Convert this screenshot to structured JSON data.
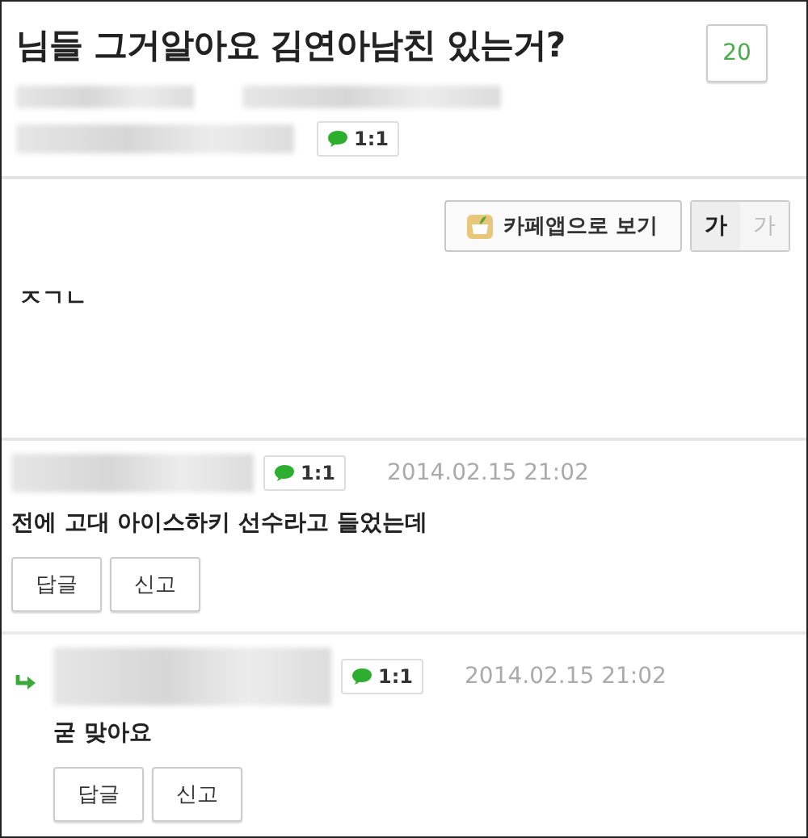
{
  "post": {
    "title": "님들 그거알아요 김연아남친 있는거?",
    "comment_count": "20",
    "chat_label": "1:1"
  },
  "toolbar": {
    "app_button": "카페앱으로 보기",
    "font_sizes": [
      {
        "label": "가",
        "selected": true
      },
      {
        "label": "가",
        "selected": false
      }
    ]
  },
  "body": "ㅈㄱㄴ",
  "comments": [
    {
      "kind": "comment",
      "chat_label": "1:1",
      "time": "2014.02.15 21:02",
      "text": "전에 고대 아이스하키 선수라고 들었는데",
      "actions": [
        "답글",
        "신고"
      ]
    },
    {
      "kind": "reply",
      "chat_label": "1:1",
      "time": "2014.02.15 21:02",
      "text": "굳 맞아요",
      "actions": [
        "답글",
        "신고"
      ]
    }
  ]
}
